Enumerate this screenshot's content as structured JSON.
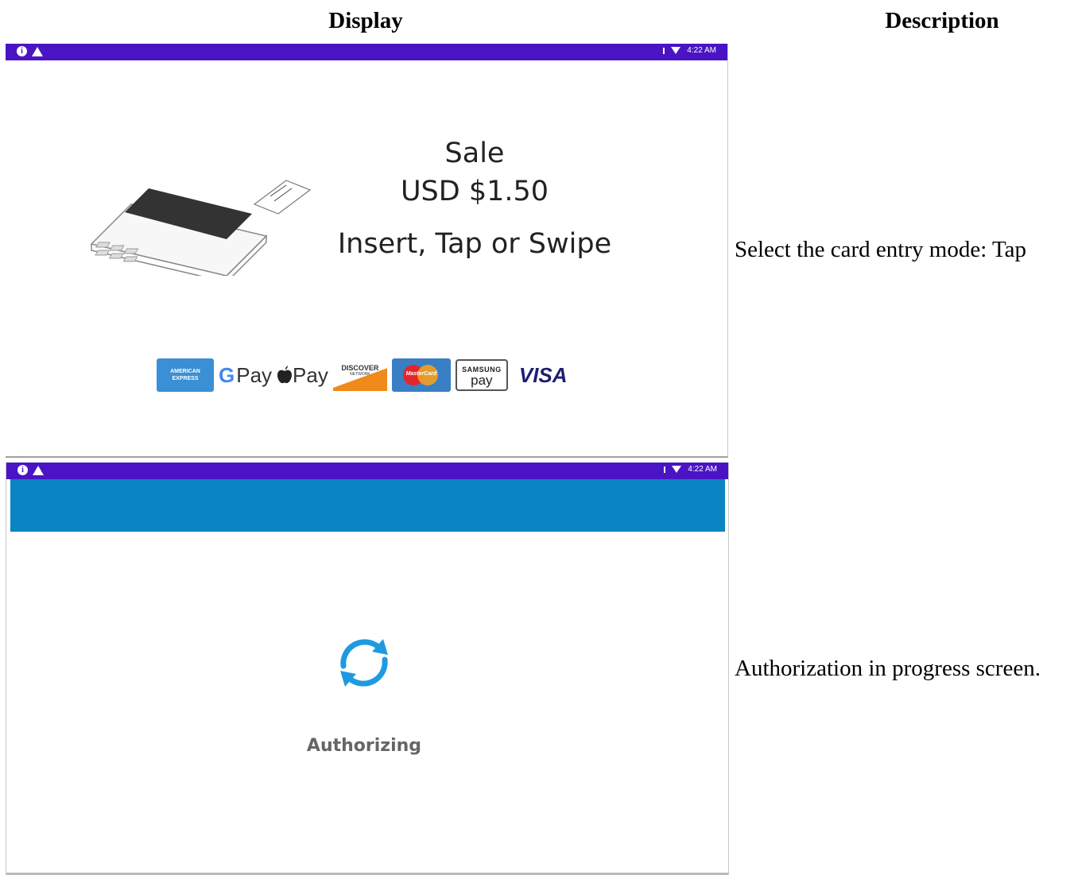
{
  "headers": {
    "display": "Display",
    "description": "Description"
  },
  "status_bar": {
    "time": "4:22 AM",
    "icons": [
      "info-icon",
      "warning-icon",
      "signal-icon",
      "wifi-icon"
    ]
  },
  "screen1": {
    "title": "Sale",
    "amount": "USD $1.50",
    "prompt": "Insert, Tap or Swipe",
    "payment_logos": {
      "amex_line1": "AMERICAN",
      "amex_line2": "EXPRESS",
      "gpay": "Pay",
      "gpay_g": "G",
      "applepay": "Pay",
      "discover": "DISCOVER",
      "discover_sub": "NETWORK",
      "mastercard": "MasterCard",
      "samsung_line1": "SAMSUNG",
      "samsung_line2": "pay",
      "visa": "VISA"
    }
  },
  "screen2": {
    "label": "Authorizing"
  },
  "descriptions": {
    "row1": "Select the card entry mode: Tap",
    "row2": "Authorization in progress screen."
  },
  "colors": {
    "status_bar": "#4a14c4",
    "header_bar": "#0a84c2",
    "spinner": "#1e9be0"
  }
}
